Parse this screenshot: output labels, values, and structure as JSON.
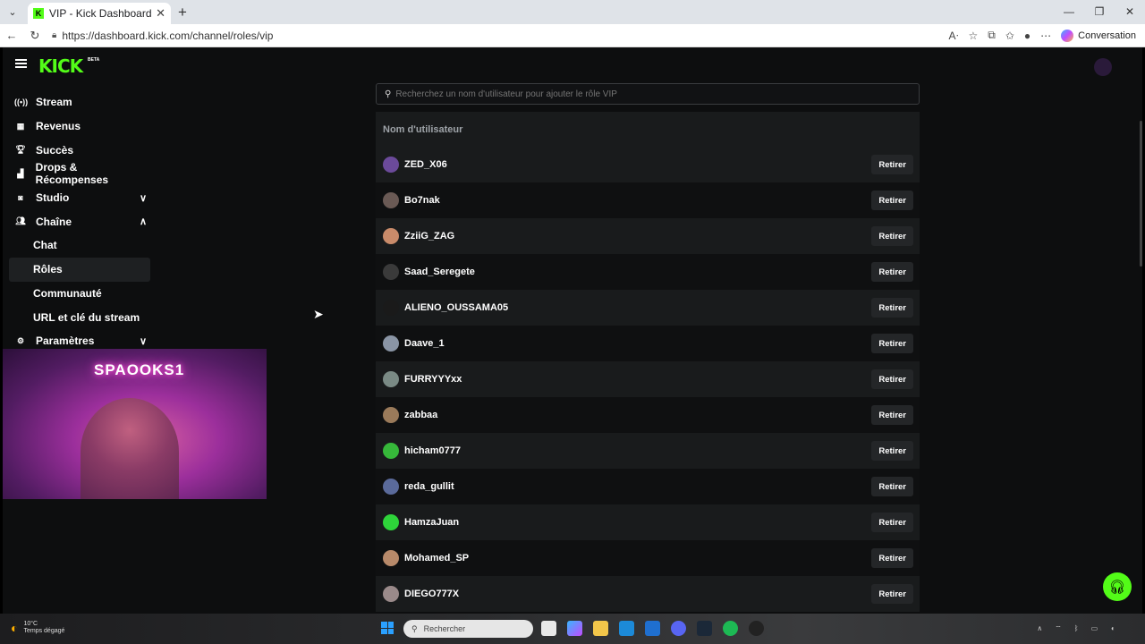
{
  "browser": {
    "tab_title": "VIP - Kick Dashboard",
    "url": "https://dashboard.kick.com/channel/roles/vip",
    "conversation_label": "Conversation"
  },
  "app": {
    "logo": "KICK",
    "beta": "BETA"
  },
  "sidebar": {
    "items": [
      {
        "label": "Stream",
        "icon": "broadcast-icon"
      },
      {
        "label": "Revenus",
        "icon": "chart-icon"
      },
      {
        "label": "Succès",
        "icon": "trophy-icon"
      },
      {
        "label": "Drops & Récompenses",
        "icon": "drops-icon"
      },
      {
        "label": "Studio",
        "icon": "studio-icon"
      },
      {
        "label": "Chaîne",
        "icon": "people-icon"
      },
      {
        "label": "Chat"
      },
      {
        "label": "Rôles"
      },
      {
        "label": "Communauté"
      },
      {
        "label": "URL et clé du stream"
      },
      {
        "label": "Paramètres",
        "icon": "gear-icon"
      }
    ]
  },
  "webcam": {
    "neon_sign": "SPAOOKS1"
  },
  "vip": {
    "search_placeholder": "Recherchez un nom d'utilisateur pour ajouter le rôle VIP",
    "column_header": "Nom d'utilisateur",
    "remove_label": "Retirer",
    "users": [
      {
        "name": "ZED_X06",
        "avatar_color": "#6b4a9a"
      },
      {
        "name": "Bo7nak",
        "avatar_color": "#6a5a55"
      },
      {
        "name": "ZziiG_ZAG",
        "avatar_color": "#c98b6a"
      },
      {
        "name": "Saad_Seregete",
        "avatar_color": "#3a3a3a"
      },
      {
        "name": "ALIENO_OUSSAMA05",
        "avatar_color": "#1a1a1a"
      },
      {
        "name": "Daave_1",
        "avatar_color": "#8a95a5"
      },
      {
        "name": "FURRYYYxx",
        "avatar_color": "#7a8a85"
      },
      {
        "name": "zabbaa",
        "avatar_color": "#9a7a5a"
      },
      {
        "name": "hicham0777",
        "avatar_color": "#36b83a"
      },
      {
        "name": "reda_gullit",
        "avatar_color": "#5a6a9a"
      },
      {
        "name": "HamzaJuan",
        "avatar_color": "#2ed43a"
      },
      {
        "name": "Mohamed_SP",
        "avatar_color": "#b88a6a"
      },
      {
        "name": "DIEGO777X",
        "avatar_color": "#9a8a8a"
      }
    ]
  },
  "taskbar": {
    "search_label": "Rechercher",
    "weather_temp": "10°C",
    "weather_desc": "Temps dégagé"
  },
  "colors": {
    "accent": "#53fc18",
    "background": "#0d0e0f",
    "row_alt": "#191b1c"
  }
}
